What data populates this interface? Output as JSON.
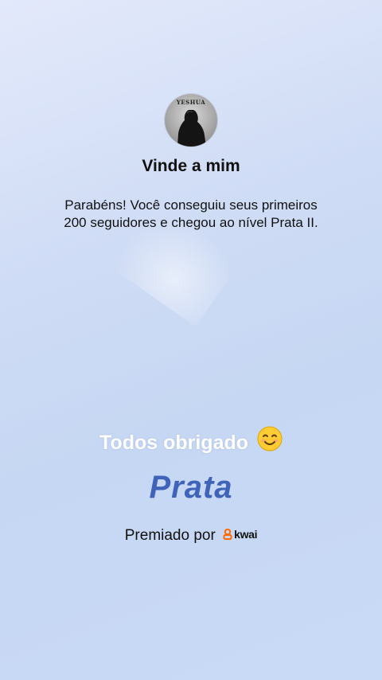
{
  "profile": {
    "avatar_label": "YESHUA",
    "name": "Vinde a mim"
  },
  "message": {
    "line1": "Parabéns! Você conseguiu seus primeiros",
    "line2": "200 seguidores e chegou ao nível Prata II."
  },
  "caption": {
    "text": "Todos obrigado",
    "emoji_icon": "smiling-face-emoji"
  },
  "level": {
    "name": "Prata"
  },
  "awarded_by": {
    "text": "Premiado por",
    "brand": "kwai",
    "brand_icon": "kwai-logo-icon",
    "brand_color": "#ff6a00"
  },
  "colors": {
    "level_text": "#3f63b8",
    "caption_text": "#ffffff"
  }
}
